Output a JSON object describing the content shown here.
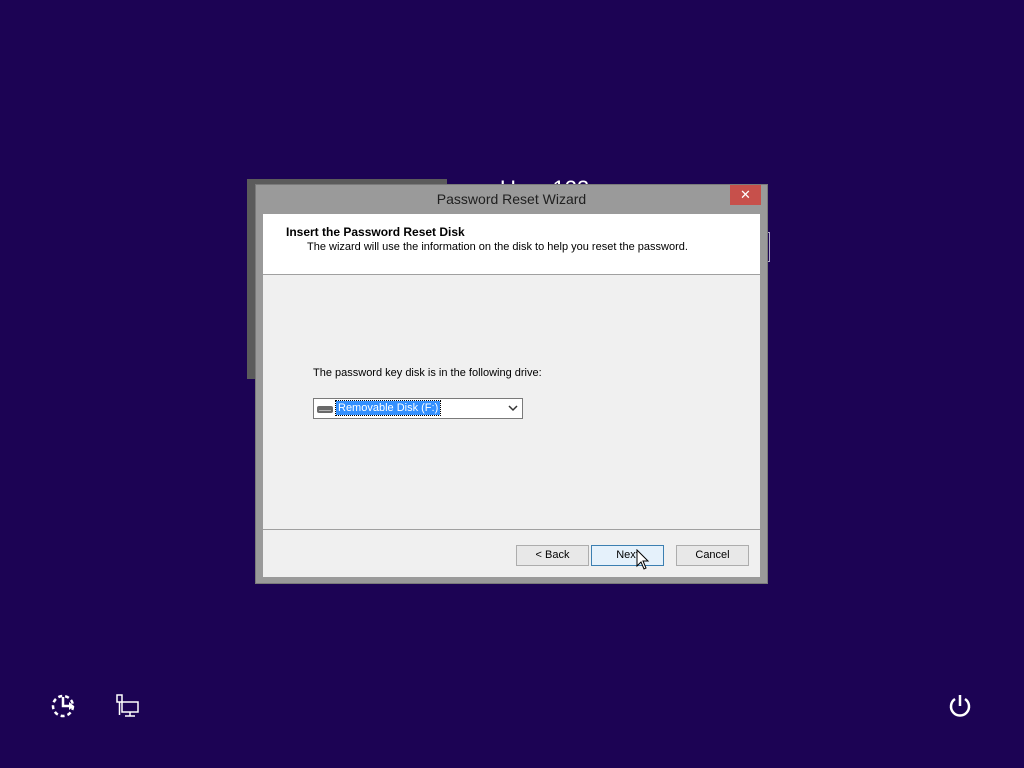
{
  "background": {
    "username_partial": "User 123"
  },
  "dialog": {
    "title": "Password Reset Wizard",
    "close_label": "✕",
    "header_title": "Insert the Password Reset Disk",
    "header_subtitle": "The wizard will use the information on the disk to help you reset the password.",
    "drive_label": "The password key disk is in the following drive:",
    "drive_select_value": "Removable Disk (F:)",
    "drive_icon": "removable-drive-icon",
    "buttons": {
      "back": "< Back",
      "next": "Next",
      "cancel": "Cancel"
    }
  },
  "bottom_bar": {
    "left_icons": [
      "ease-of-access-icon",
      "network-icon"
    ],
    "right_icons": [
      "power-icon"
    ]
  },
  "colors": {
    "desktop_background": "#1c0354",
    "close_button": "#c7504b",
    "selection_highlight": "#3390ff"
  }
}
